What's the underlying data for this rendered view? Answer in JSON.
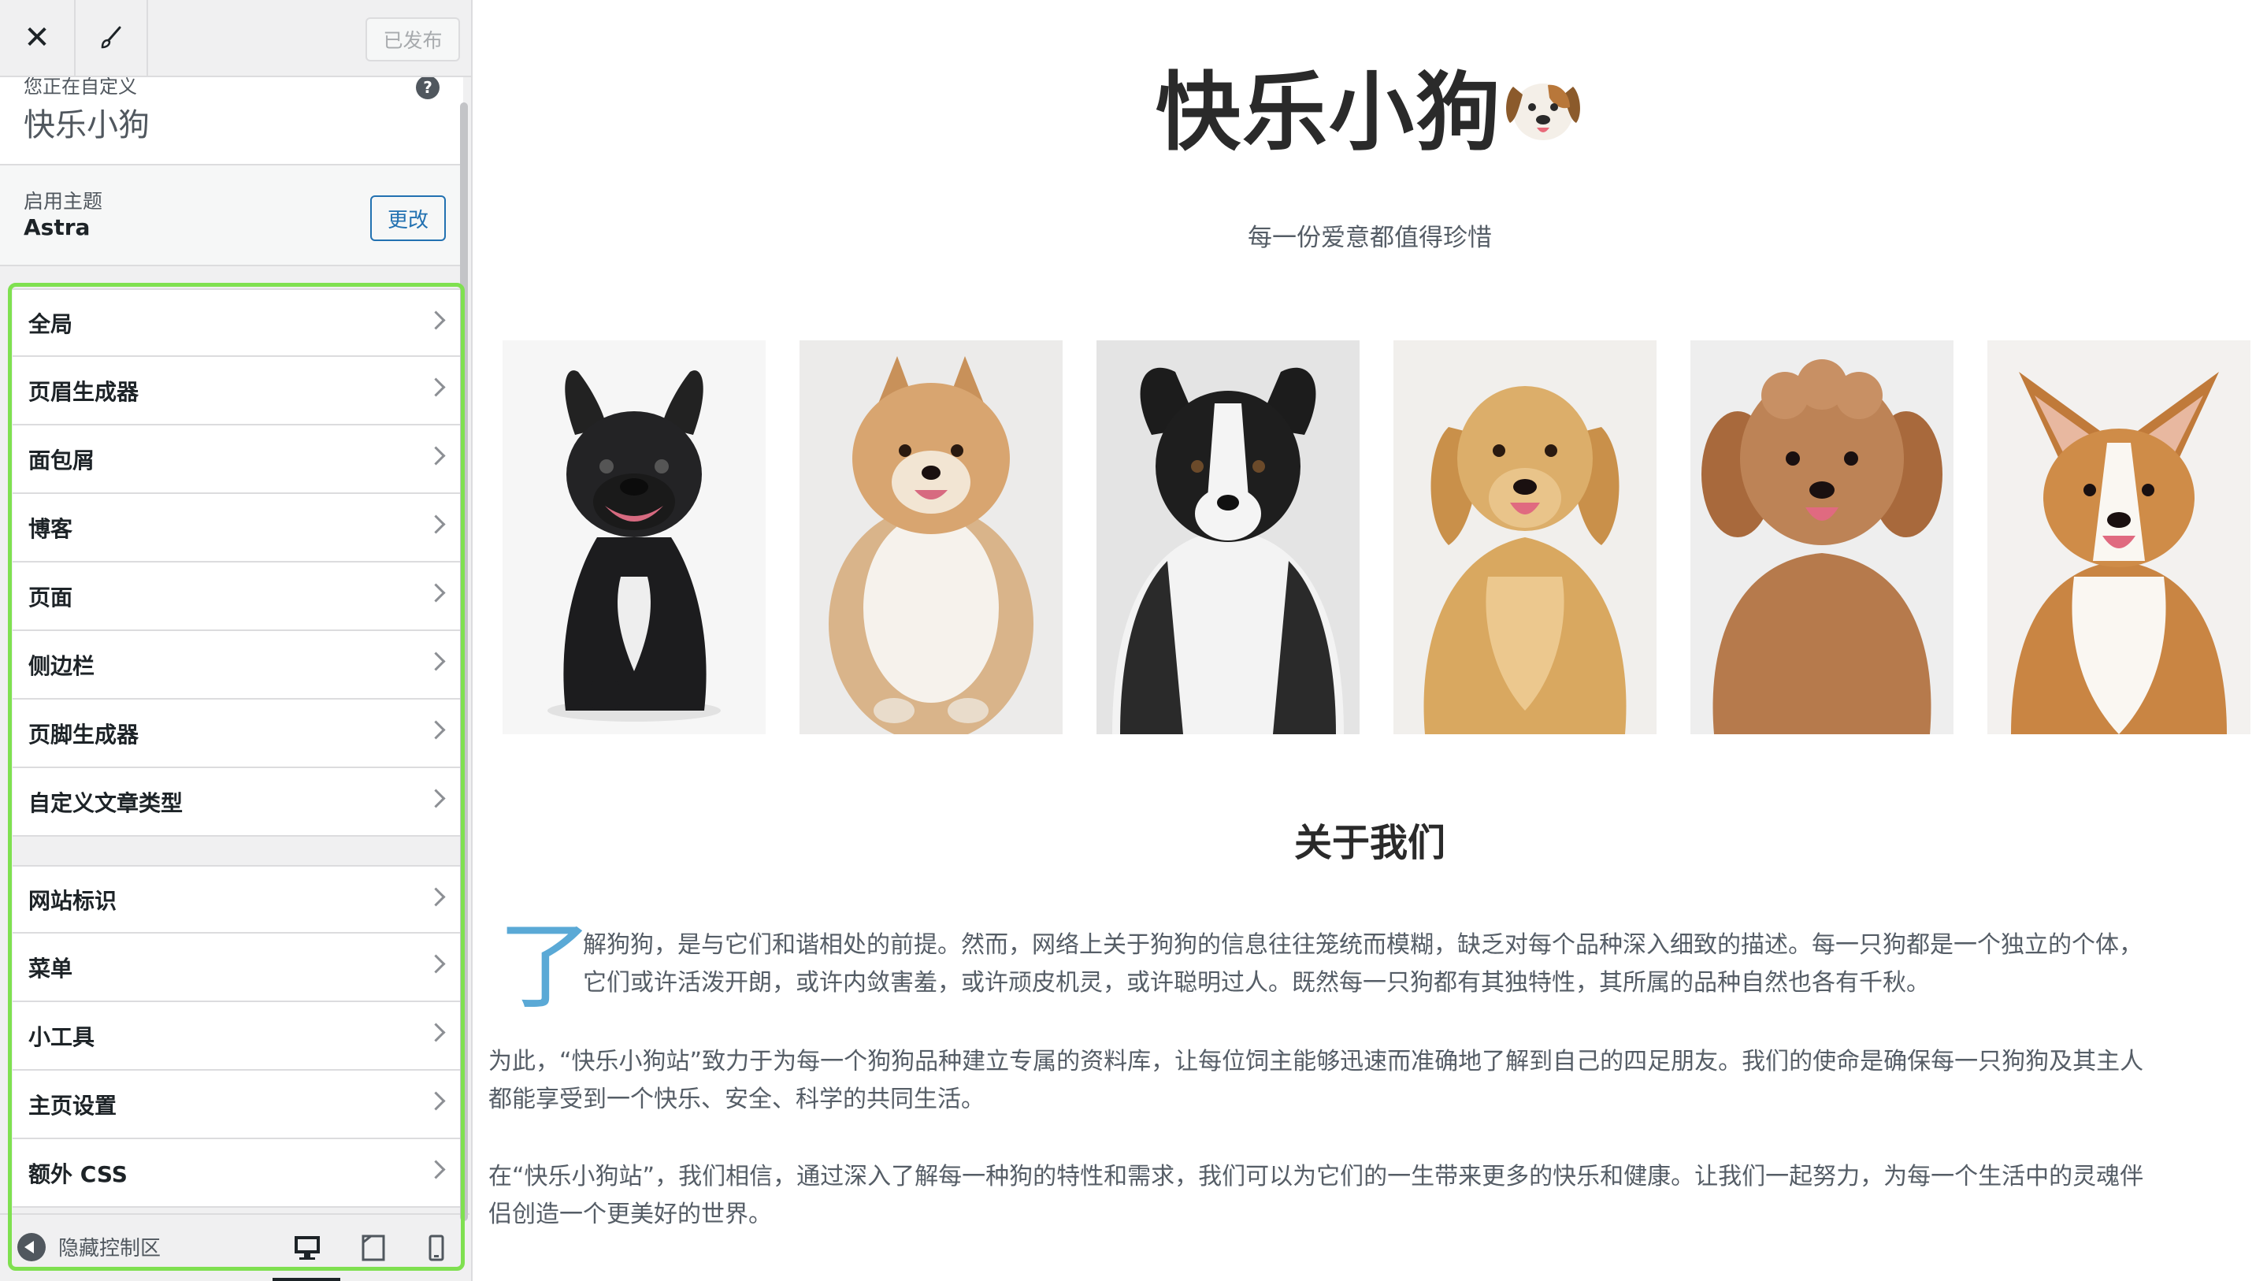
{
  "sidebar": {
    "publish_label": "已发布",
    "customizing_label": "您正在自定义",
    "site_name": "快乐小狗",
    "theme_label": "启用主题",
    "theme_name": "Astra",
    "change_label": "更改",
    "group1": [
      {
        "label": "全局"
      },
      {
        "label": "页眉生成器"
      },
      {
        "label": "面包屑"
      },
      {
        "label": "博客"
      },
      {
        "label": "页面"
      },
      {
        "label": "侧边栏"
      },
      {
        "label": "页脚生成器"
      },
      {
        "label": "自定义文章类型"
      }
    ],
    "group2": [
      {
        "label": "网站标识"
      },
      {
        "label": "菜单"
      },
      {
        "label": "小工具"
      },
      {
        "label": "主页设置"
      },
      {
        "label": "额外 CSS"
      }
    ],
    "collapse_label": "隐藏控制区",
    "active_device": "desktop"
  },
  "preview": {
    "site_title": "快乐小狗",
    "site_title_emoji": "🐶",
    "tagline": "每一份爱意都值得珍惜",
    "about_title": "关于我们",
    "dropcap": "了",
    "para1_line1": "解狗狗，是与它们和谐相处的前提。然而，网络上关于狗狗的信息往往笼统而模糊，缺乏对每个品种深入细致的描述。每一只狗都是一个独立的个体，",
    "para1_line2": "它们或许活泼开朗，或许内敛害羞，或许顽皮机灵，或许聪明过人。既然每一只狗都有其独特性，其所属的品种自然也各有千秋。",
    "para2_line1": "为此，“快乐小狗站”致力于为每一个狗狗品种建立专属的资料库，让每位饲主能够迅速而准确地了解到自己的四足朋友。我们的使命是确保每一只狗狗及其主人",
    "para2_line2": "都能享受到一个快乐、安全、科学的共同生活。",
    "para3_line1": "在“快乐小狗站”，我们相信，通过深入了解每一种狗的特性和需求，我们可以为它们的一生带来更多的快乐和健康。让我们一起努力，为每一个生活中的灵魂伴",
    "para3_line2": "侣创造一个更美好的世界。",
    "photos": [
      {
        "name": "french-bulldog"
      },
      {
        "name": "pomeranian"
      },
      {
        "name": "border-collie"
      },
      {
        "name": "golden-retriever"
      },
      {
        "name": "poodle"
      },
      {
        "name": "corgi"
      }
    ]
  },
  "colors": {
    "highlight": "#7fe050",
    "accent": "#2271b1",
    "dropcap": "#5aa9d6"
  }
}
